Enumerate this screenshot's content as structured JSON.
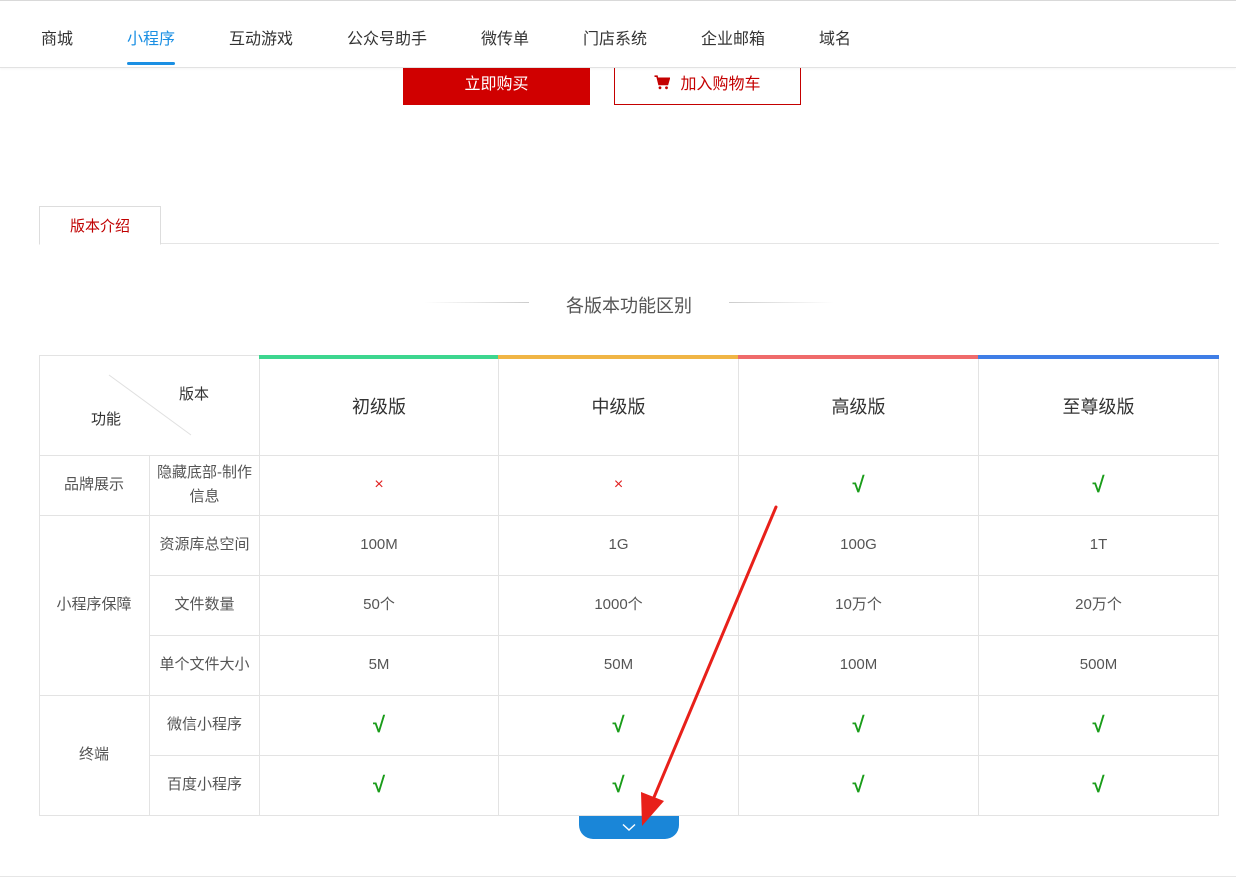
{
  "nav": {
    "items": [
      {
        "label": "商城"
      },
      {
        "label": "小程序"
      },
      {
        "label": "互动游戏"
      },
      {
        "label": "公众号助手"
      },
      {
        "label": "微传单"
      },
      {
        "label": "门店系统"
      },
      {
        "label": "企业邮箱"
      },
      {
        "label": "域名"
      }
    ],
    "active_index": 1
  },
  "actions": {
    "buy_label": "立即购买",
    "cart_label": "加入购物车",
    "cart_icon": "shopping-cart-icon"
  },
  "tab": {
    "label": "版本介绍"
  },
  "section": {
    "title": "各版本功能区别"
  },
  "table": {
    "corner": {
      "top": "版本",
      "bottom": "功能"
    },
    "versions": [
      {
        "name": "初级版",
        "color": "#3dd68f"
      },
      {
        "name": "中级版",
        "color": "#f0b545"
      },
      {
        "name": "高级版",
        "color": "#ef6b6b"
      },
      {
        "name": "至尊级版",
        "color": "#3f7ee6"
      }
    ],
    "groups": [
      {
        "label": "品牌展示"
      },
      {
        "label": "小程序保障"
      },
      {
        "label": "终端"
      }
    ],
    "rows": [
      {
        "feature": "隐藏底部-制作信息",
        "values": [
          "×",
          "×",
          "√",
          "√"
        ]
      },
      {
        "feature": "资源库总空间",
        "values": [
          "100M",
          "1G",
          "100G",
          "1T"
        ]
      },
      {
        "feature": "文件数量",
        "values": [
          "50个",
          "1000个",
          "10万个",
          "20万个"
        ]
      },
      {
        "feature": "单个文件大小",
        "values": [
          "5M",
          "50M",
          "100M",
          "500M"
        ]
      },
      {
        "feature": "微信小程序",
        "values": [
          "√",
          "√",
          "√",
          "√"
        ]
      },
      {
        "feature": "百度小程序",
        "values": [
          "√",
          "√",
          "√",
          "√"
        ]
      }
    ]
  },
  "expand": {
    "icon": "chevron-down-icon"
  },
  "annotation": {
    "color": "#e8201a",
    "icon": "arrow-annotation-icon"
  }
}
